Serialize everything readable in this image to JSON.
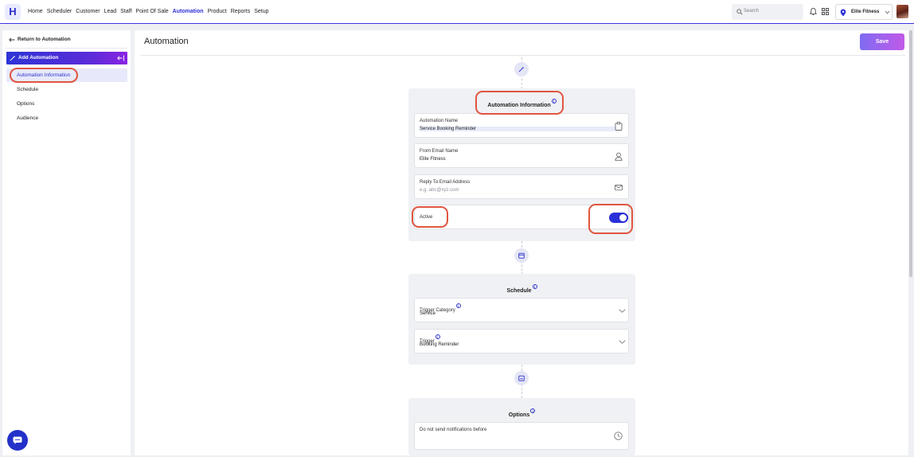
{
  "app": {
    "logo": "H"
  },
  "nav": {
    "items": [
      "Home",
      "Scheduler",
      "Customer",
      "Lead",
      "Staff",
      "Point Of Sale",
      "Automation",
      "Product",
      "Reports",
      "Setup"
    ],
    "active": "Automation"
  },
  "header": {
    "search_placeholder": "Search",
    "location": "Elite Fitness"
  },
  "sidebar": {
    "back_label": "Return to Automation",
    "section_label": "Add Automation",
    "items": [
      "Automation Information",
      "Schedule",
      "Options",
      "Audience"
    ],
    "selected": "Automation Information"
  },
  "main": {
    "title": "Automation",
    "save_label": "Save"
  },
  "automation_info": {
    "title": "Automation Information",
    "name_label": "Automation Name",
    "name_value": "Service Booking Reminder",
    "from_label": "From Email Name",
    "from_value": "Elite Fitness",
    "reply_label": "Reply To Email Address",
    "reply_placeholder": "e.g. abc@xyz.com",
    "active_label": "Active",
    "active": true
  },
  "schedule": {
    "title": "Schedule",
    "trigger_category_label": "Trigger Category",
    "trigger_category_value": "Service",
    "trigger_label": "Trigger",
    "trigger_value": "Booking Reminder"
  },
  "options": {
    "title": "Options",
    "notify_label": "Do not send notifications before"
  },
  "colors": {
    "accent": "#2b31d8",
    "highlight_ring": "#e0553f",
    "save_gradient_start": "#7f6bf2",
    "save_gradient_end": "#c15ae8"
  },
  "icons": {
    "search": "search-icon",
    "bell": "bell-icon",
    "grid": "grid-icon",
    "location": "location-pin-icon",
    "back": "arrow-left-icon",
    "wand": "magic-wand-icon",
    "collapse": "collapse-icon",
    "clipboard": "clipboard-icon",
    "user": "user-icon",
    "mail": "mail-icon",
    "calendar": "calendar-icon",
    "chat": "chat-icon",
    "clock": "clock-icon"
  }
}
